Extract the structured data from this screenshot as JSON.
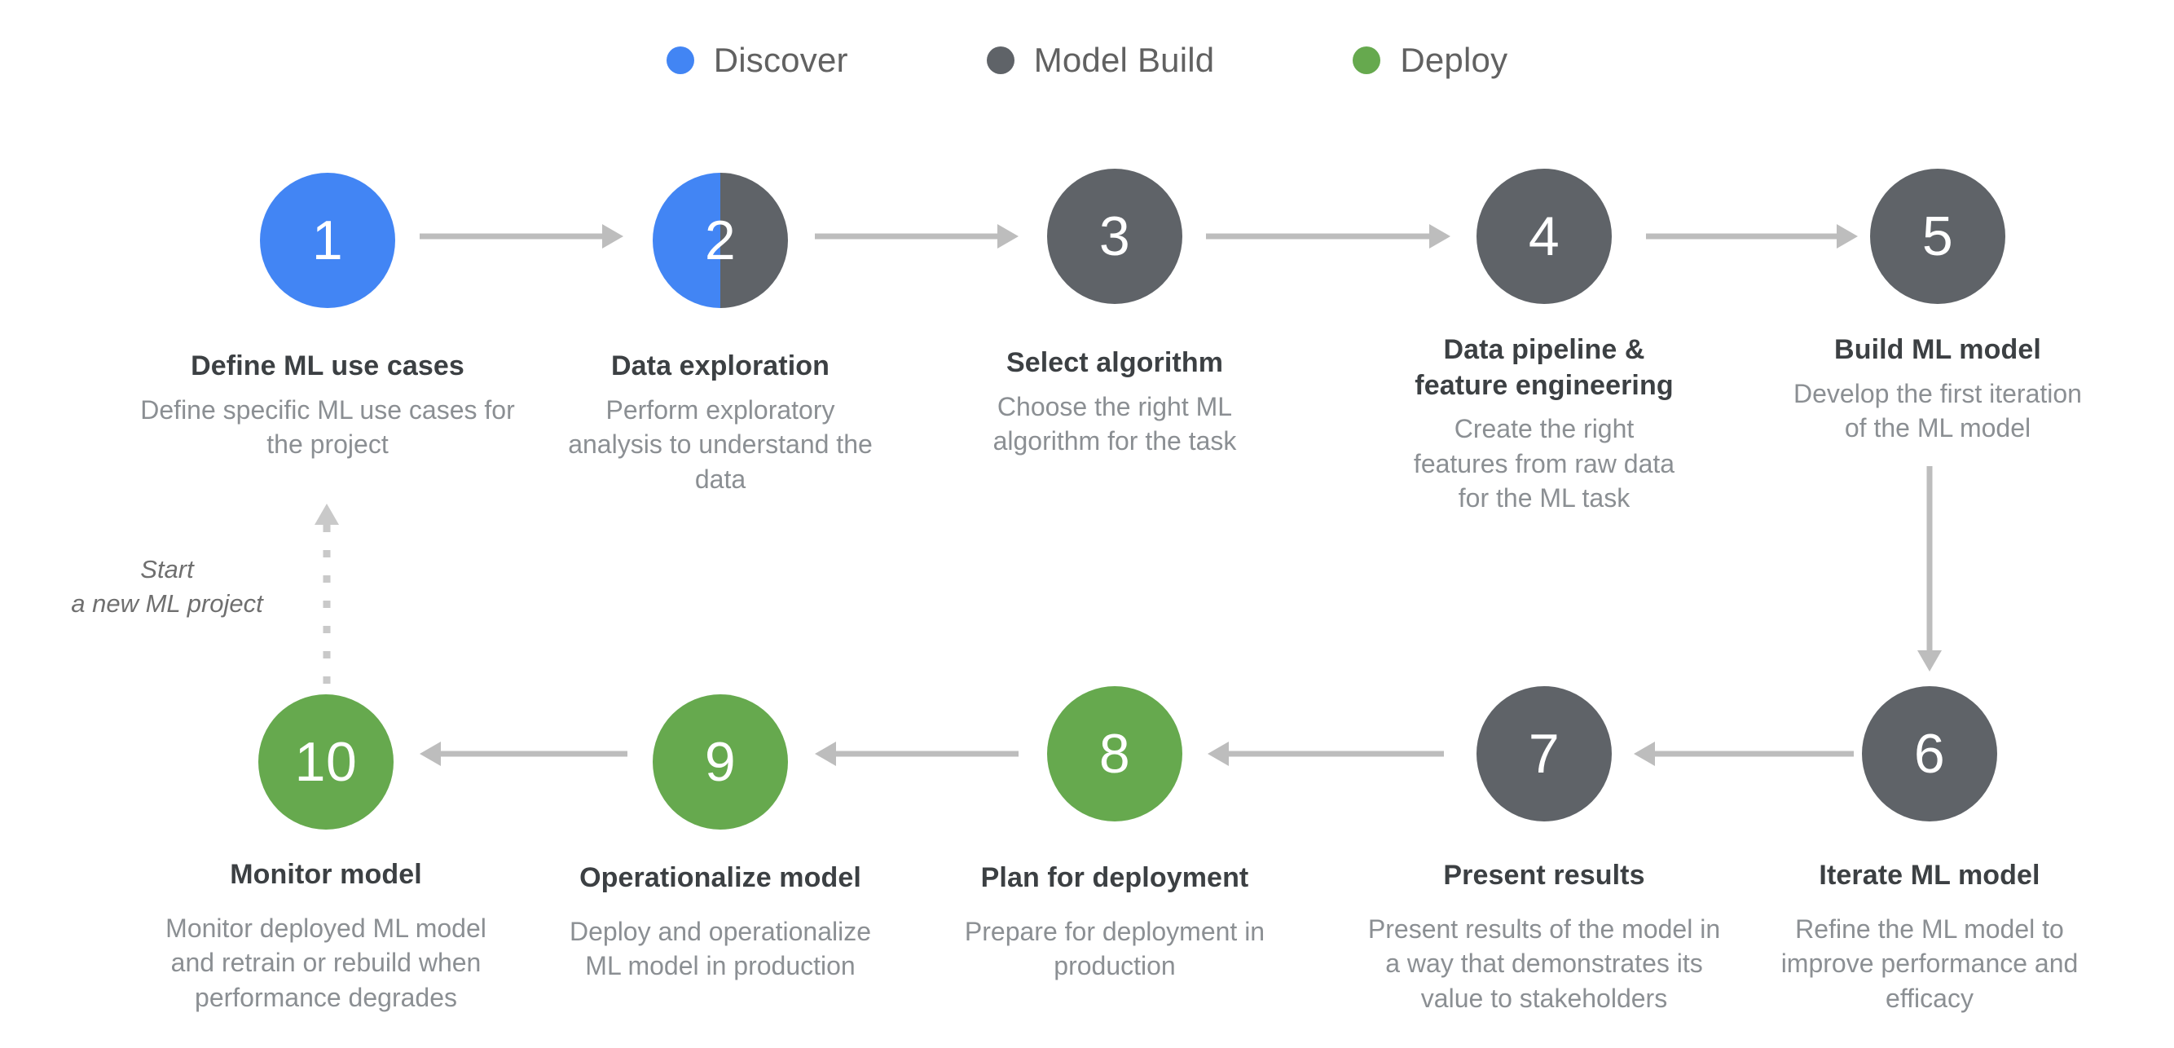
{
  "colors": {
    "discover": "#4285F4",
    "model_build": "#5F6368",
    "deploy": "#66A94E",
    "connector": "#BDBDBD",
    "dotted": "#C9C9C9",
    "title_text": "#3C4043",
    "desc_text": "#8B8F93",
    "legend_text": "#616161",
    "background": "#FFFFFF"
  },
  "legend": {
    "items": [
      {
        "label": "Discover",
        "color_key": "discover",
        "icon": "filled-circle-icon"
      },
      {
        "label": "Model Build",
        "color_key": "model_build",
        "icon": "filled-circle-icon"
      },
      {
        "label": "Deploy",
        "color_key": "deploy",
        "icon": "filled-circle-icon"
      }
    ]
  },
  "restart_note": {
    "line1": "Start",
    "line2": "a new ML project",
    "full": "Start\na new ML project"
  },
  "steps": [
    {
      "number": "1",
      "title": "Define ML use cases",
      "description": "Define specific ML use cases for\nthe project",
      "phase": "Discover",
      "fill": "solid",
      "row": "top"
    },
    {
      "number": "2",
      "title": "Data exploration",
      "description": "Perform exploratory\nanalysis to understand the\ndata",
      "phase": "Discover / Model Build",
      "fill": "split",
      "row": "top"
    },
    {
      "number": "3",
      "title": "Select algorithm",
      "description": "Choose the right ML\nalgorithm for the task",
      "phase": "Model Build",
      "fill": "solid",
      "row": "top"
    },
    {
      "number": "4",
      "title": "Data pipeline &\nfeature engineering",
      "description": "Create the right\nfeatures from raw data\nfor the ML task",
      "phase": "Model Build",
      "fill": "solid",
      "row": "top"
    },
    {
      "number": "5",
      "title": "Build ML model",
      "description": "Develop the first iteration\nof the ML model",
      "phase": "Model Build",
      "fill": "solid",
      "row": "top"
    },
    {
      "number": "6",
      "title": "Iterate ML model",
      "description": "Refine the ML model to\nimprove performance and\nefficacy",
      "phase": "Model Build",
      "fill": "solid",
      "row": "bottom"
    },
    {
      "number": "7",
      "title": "Present results",
      "description": "Present results of the model in\na way that demonstrates its\nvalue to stakeholders",
      "phase": "Model Build",
      "fill": "solid",
      "row": "bottom"
    },
    {
      "number": "8",
      "title": "Plan for deployment",
      "description": "Prepare for deployment in\nproduction",
      "phase": "Deploy",
      "fill": "solid",
      "row": "bottom"
    },
    {
      "number": "9",
      "title": "Operationalize model",
      "description": "Deploy and operationalize\nML model in production",
      "phase": "Deploy",
      "fill": "solid",
      "row": "bottom"
    },
    {
      "number": "10",
      "title": "Monitor model",
      "description": "Monitor deployed ML model\nand retrain or rebuild when\nperformance degrades",
      "phase": "Deploy",
      "fill": "solid",
      "row": "bottom"
    }
  ]
}
